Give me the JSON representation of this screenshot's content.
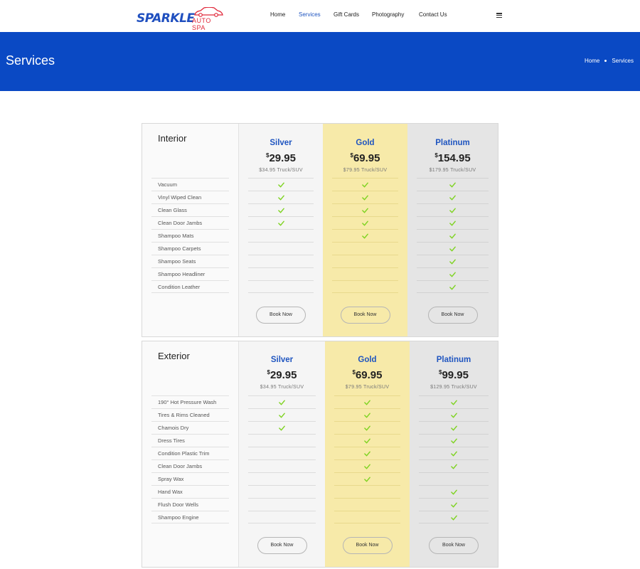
{
  "brand": {
    "name": "SPARKLE",
    "sub": "AUTO SPA",
    "colors": {
      "primary": "#0a49c4",
      "accent": "#e0283a",
      "check": "#7ed321",
      "gold_bg": "#f7eaa9"
    }
  },
  "nav": {
    "items": [
      {
        "label": "Home",
        "active": false
      },
      {
        "label": "Services",
        "active": true
      },
      {
        "label": "Gift Cards",
        "active": false
      },
      {
        "label": "Photography",
        "active": false
      },
      {
        "label": "Contact Us",
        "active": false
      }
    ],
    "menu_icon": "hamburger-icon"
  },
  "banner": {
    "title": "Services",
    "breadcrumb": [
      "Home",
      "Services"
    ]
  },
  "interior": {
    "title": "Interior",
    "features": [
      "Vacuum",
      "Vinyl Wiped Clean",
      "Clean Glass",
      "Clean Door Jambs",
      "Shampoo Mats",
      "Shampoo Carpets",
      "Shampoo Seats",
      "Shampoo Headliner",
      "Condition Leather"
    ],
    "tiers": [
      {
        "name": "Silver",
        "currency": "$",
        "price": "29.95",
        "alt": "$34.95 Truck/SUV",
        "checks": [
          1,
          1,
          1,
          1,
          0,
          0,
          0,
          0,
          0
        ],
        "button": "Book Now"
      },
      {
        "name": "Gold",
        "currency": "$",
        "price": "69.95",
        "alt": "$79.95 Truck/SUV",
        "checks": [
          1,
          1,
          1,
          1,
          1,
          0,
          0,
          0,
          0
        ],
        "button": "Book Now"
      },
      {
        "name": "Platinum",
        "currency": "$",
        "price": "154.95",
        "alt": "$179.95 Truck/SUV",
        "checks": [
          1,
          1,
          1,
          1,
          1,
          1,
          1,
          1,
          1
        ],
        "button": "Book Now"
      }
    ]
  },
  "exterior": {
    "title": "Exterior",
    "features": [
      "190° Hot Pressure Wash",
      "Tires & Rims Cleaned",
      "Chamois Dry",
      "Dress Tires",
      "Condition Plastic Trim",
      "Clean Door Jambs",
      "Spray Wax",
      "Hand Wax",
      "Flush Door Wells",
      "Shampoo Engine"
    ],
    "tiers": [
      {
        "name": "Silver",
        "currency": "$",
        "price": "29.95",
        "alt": "$34.95 Truck/SUV",
        "checks": [
          1,
          1,
          1,
          0,
          0,
          0,
          0,
          0,
          0,
          0
        ],
        "button": "Book Now"
      },
      {
        "name": "Gold",
        "currency": "$",
        "price": "69.95",
        "alt": "$79.95 Truck/SUV",
        "checks": [
          1,
          1,
          1,
          1,
          1,
          1,
          1,
          0,
          0,
          0
        ],
        "button": "Book Now"
      },
      {
        "name": "Platinum",
        "currency": "$",
        "price": "99.95",
        "alt": "$129.95 Truck/SUV",
        "checks": [
          1,
          1,
          1,
          1,
          1,
          1,
          0,
          1,
          1,
          1
        ],
        "button": "Book Now"
      }
    ]
  }
}
